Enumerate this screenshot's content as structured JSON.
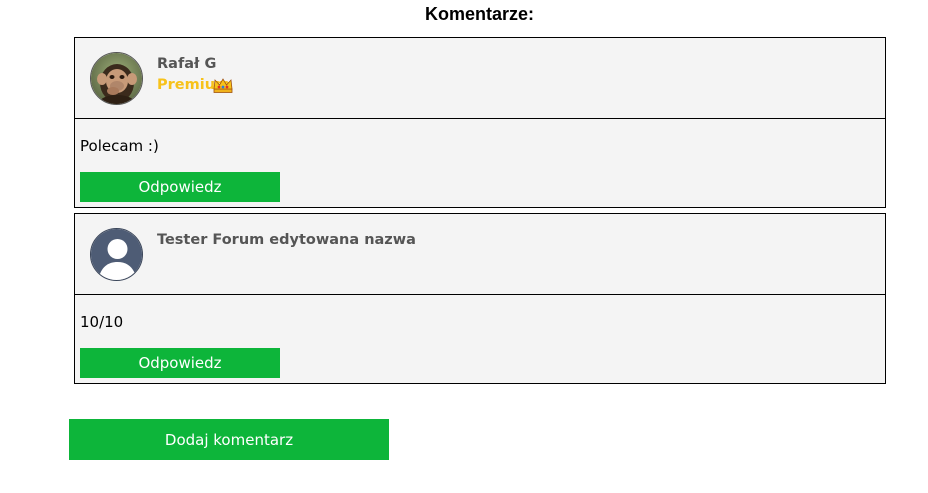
{
  "section": {
    "title": "Komentarze:"
  },
  "comments": [
    {
      "author": "Rafał G",
      "rank": "Premium",
      "rank_icon": "crown-icon",
      "avatar": "monkey-photo-avatar",
      "text": "Polecam :)",
      "reply_label": "Odpowiedz"
    },
    {
      "author": "Tester Forum edytowana nazwa",
      "avatar": "default-user-avatar",
      "text": "10/10",
      "reply_label": "Odpowiedz"
    }
  ],
  "actions": {
    "add_comment_label": "Dodaj komentarz"
  },
  "colors": {
    "button_green": "#0db53a",
    "premium_gold": "#f7c21a",
    "card_background": "#f4f4f4",
    "author_gray": "#555555",
    "default_avatar_blue": "#4e5c75"
  }
}
